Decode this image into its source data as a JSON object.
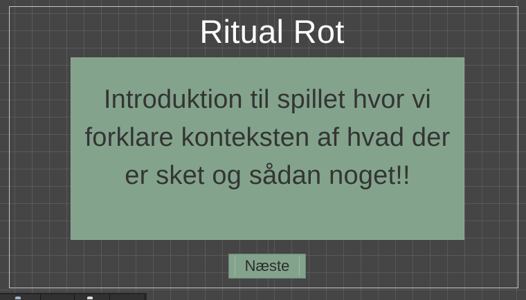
{
  "title": "Ritual Rot",
  "intro_text": "Introduktion til spillet hvor vi forklare konteksten af hvad der er sket og sådan noget!!",
  "next_button_label": "Næste",
  "colors": {
    "background": "#454545",
    "panel": "#84a38d",
    "title": "#ffffff",
    "text": "#333533"
  },
  "toolbar": {
    "tools": [
      "tool-icon",
      "tool",
      "tool-icon",
      "tool"
    ]
  }
}
